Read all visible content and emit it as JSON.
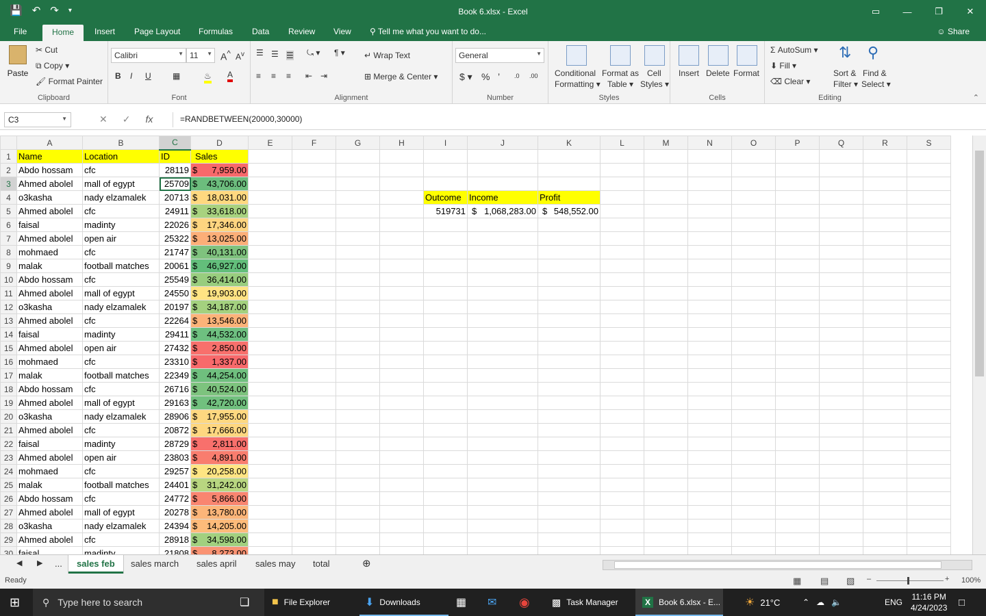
{
  "window": {
    "title": "Book 6.xlsx  -  Excel"
  },
  "tabs": [
    "File",
    "Home",
    "Insert",
    "Page Layout",
    "Formulas",
    "Data",
    "Review",
    "View"
  ],
  "tell_me": "Tell me what you want to do...",
  "share": "Share",
  "ribbon": {
    "clipboard": {
      "paste": "Paste",
      "cut": "Cut",
      "copy": "Copy",
      "format_painter": "Format Painter",
      "label": "Clipboard"
    },
    "font": {
      "name": "Calibri",
      "size": "11",
      "label": "Font"
    },
    "alignment": {
      "wrap": "Wrap Text",
      "merge": "Merge & Center",
      "label": "Alignment"
    },
    "number": {
      "format": "General",
      "label": "Number"
    },
    "styles": {
      "cond": "Conditional",
      "cond2": "Formatting",
      "fmt_table": "Format as",
      "fmt_table2": "Table",
      "cell_styles": "Cell",
      "cell_styles2": "Styles",
      "label": "Styles"
    },
    "cells": {
      "insert": "Insert",
      "delete": "Delete",
      "format": "Format",
      "label": "Cells"
    },
    "editing": {
      "autosum": "AutoSum",
      "fill": "Fill",
      "clear": "Clear",
      "sort": "Sort &",
      "sort2": "Filter",
      "find": "Find &",
      "find2": "Select",
      "label": "Editing"
    }
  },
  "formula_bar": {
    "name_box": "C3",
    "formula": "=RANDBETWEEN(20000,30000)",
    "fx": "fx"
  },
  "columns": [
    "A",
    "B",
    "C",
    "D",
    "E",
    "F",
    "G",
    "H",
    "I",
    "J",
    "K",
    "L",
    "M",
    "N",
    "O",
    "P",
    "Q",
    "R",
    "S"
  ],
  "headers": {
    "name": "Name",
    "location": "Location",
    "id": "ID",
    "sales": "Sales"
  },
  "rows": [
    {
      "n": "Abdo hossam",
      "l": "cfc",
      "id": "28119",
      "s": "7,959.00",
      "c": "#f8696b"
    },
    {
      "n": "Ahmed abolel",
      "l": "mall of egypt",
      "id": "25709",
      "s": "43,706.00",
      "c": "#6cbd7d"
    },
    {
      "n": "o3kasha",
      "l": "nady elzamalek",
      "id": "20713",
      "s": "18,031.00",
      "c": "#ffd87f"
    },
    {
      "n": "Ahmed abolel",
      "l": "cfc",
      "id": "24911",
      "s": "33,618.00",
      "c": "#a8d27f"
    },
    {
      "n": "faisal",
      "l": "madinty",
      "id": "22026",
      "s": "17,346.00",
      "c": "#fed580"
    },
    {
      "n": "Ahmed abolel",
      "l": "open air",
      "id": "25322",
      "s": "13,025.00",
      "c": "#fcae78"
    },
    {
      "n": "mohmaed",
      "l": "cfc",
      "id": "21747",
      "s": "40,131.00",
      "c": "#7fc27e"
    },
    {
      "n": "malak",
      "l": "football matches",
      "id": "20061",
      "s": "46,927.00",
      "c": "#63be7b"
    },
    {
      "n": "Abdo hossam",
      "l": "cfc",
      "id": "25549",
      "s": "36,414.00",
      "c": "#98cd7e"
    },
    {
      "n": "Ahmed abolel",
      "l": "mall of egypt",
      "id": "24550",
      "s": "19,903.00",
      "c": "#ffe383"
    },
    {
      "n": "o3kasha",
      "l": "nady elzamalek",
      "id": "20197",
      "s": "34,187.00",
      "c": "#a4d17f"
    },
    {
      "n": "Ahmed abolel",
      "l": "cfc",
      "id": "22264",
      "s": "13,546.00",
      "c": "#fcb379"
    },
    {
      "n": "faisal",
      "l": "madinty",
      "id": "29411",
      "s": "44,532.00",
      "c": "#6ec080"
    },
    {
      "n": "Ahmed abolel",
      "l": "open air",
      "id": "27432",
      "s": "2,850.00",
      "c": "#f8706c"
    },
    {
      "n": "mohmaed",
      "l": "cfc",
      "id": "23310",
      "s": "1,337.00",
      "c": "#f8696b"
    },
    {
      "n": "malak",
      "l": "football matches",
      "id": "22349",
      "s": "44,254.00",
      "c": "#6fbf7e"
    },
    {
      "n": "Abdo hossam",
      "l": "cfc",
      "id": "26716",
      "s": "40,524.00",
      "c": "#7dc37e"
    },
    {
      "n": "Ahmed abolel",
      "l": "mall of egypt",
      "id": "29163",
      "s": "42,720.00",
      "c": "#71c07e"
    },
    {
      "n": "o3kasha",
      "l": "nady elzamalek",
      "id": "28906",
      "s": "17,955.00",
      "c": "#fed880"
    },
    {
      "n": "Ahmed abolel",
      "l": "cfc",
      "id": "20872",
      "s": "17,666.00",
      "c": "#fed780"
    },
    {
      "n": "faisal",
      "l": "madinty",
      "id": "28729",
      "s": "2,811.00",
      "c": "#f8706c"
    },
    {
      "n": "Ahmed abolel",
      "l": "open air",
      "id": "23803",
      "s": "4,891.00",
      "c": "#f97d6e"
    },
    {
      "n": "mohmaed",
      "l": "cfc",
      "id": "29257",
      "s": "20,258.00",
      "c": "#ffe583"
    },
    {
      "n": "malak",
      "l": "football matches",
      "id": "24401",
      "s": "31,242.00",
      "c": "#b8d680"
    },
    {
      "n": "Abdo hossam",
      "l": "cfc",
      "id": "24772",
      "s": "5,866.00",
      "c": "#f98570"
    },
    {
      "n": "Ahmed abolel",
      "l": "mall of egypt",
      "id": "20278",
      "s": "13,780.00",
      "c": "#fcb579"
    },
    {
      "n": "o3kasha",
      "l": "nady elzamalek",
      "id": "24394",
      "s": "14,205.00",
      "c": "#fdbb7a"
    },
    {
      "n": "Ahmed abolel",
      "l": "cfc",
      "id": "28918",
      "s": "34,598.00",
      "c": "#a2d07f"
    },
    {
      "n": "faisal",
      "l": "madinty",
      "id": "21808",
      "s": "8,273.00",
      "c": "#fa9373"
    }
  ],
  "summary": {
    "outcome_label": "Outcome",
    "income_label": "Income",
    "profit_label": "Profit",
    "outcome": "519731",
    "income": "1,068,283.00",
    "profit": "548,552.00"
  },
  "sheets": [
    "sales feb",
    "sales march",
    "sales april",
    "sales may",
    "total"
  ],
  "ellipsis": "...",
  "status": {
    "ready": "Ready",
    "zoom": "100%"
  },
  "taskbar": {
    "search": "Type here to search",
    "file_explorer": "File Explorer",
    "downloads": "Downloads",
    "task_manager": "Task Manager",
    "excel": "Book 6.xlsx - E...",
    "temp": "21°C",
    "lang": "ENG",
    "time": "11:16 PM",
    "date": "4/24/2023"
  },
  "colors": {
    "excel_green": "#217346",
    "header_yellow": "#ffff00"
  }
}
